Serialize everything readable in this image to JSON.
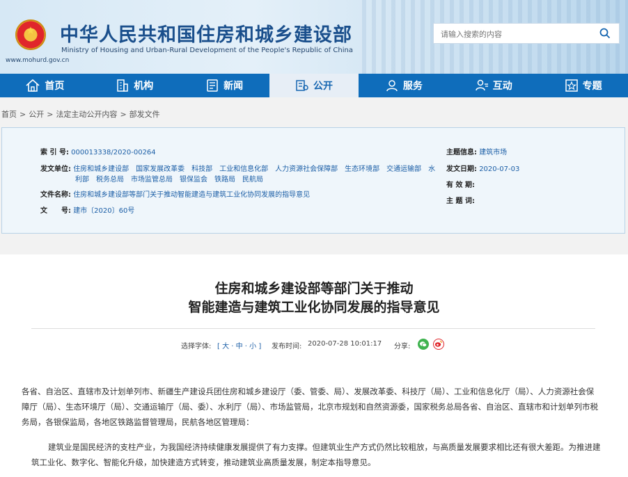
{
  "header": {
    "title": "中华人民共和国住房和城乡建设部",
    "subtitle": "Ministry of Housing and Urban-Rural Development of the People's Republic of China",
    "url": "www.mohurd.gov.cn",
    "search_placeholder": "请输入搜索的内容"
  },
  "nav": {
    "items": [
      {
        "label": "首页",
        "icon": "home-icon"
      },
      {
        "label": "机构",
        "icon": "building-icon"
      },
      {
        "label": "新闻",
        "icon": "news-icon"
      },
      {
        "label": "公开",
        "icon": "disclosure-icon"
      },
      {
        "label": "服务",
        "icon": "service-icon"
      },
      {
        "label": "互动",
        "icon": "interaction-icon"
      },
      {
        "label": "专题",
        "icon": "topic-icon"
      }
    ],
    "active": "公开"
  },
  "breadcrumb": [
    "首页",
    "公开",
    "法定主动公开内容",
    "部发文件"
  ],
  "info": {
    "index_label": "索 引 号:",
    "index_value": "000013338/2020-00264",
    "issuer_label": "发文单位:",
    "issuer_line1": "住房和城乡建设部　国家发展改革委　科技部　工业和信息化部　人力资源社会保障部　生态环境部　交通运输部　水",
    "issuer_line2": "利部　税务总局　市场监管总局　银保监会　铁路局　民航局",
    "filename_label": "文件名称:",
    "filename_value": "住房和城乡建设部等部门关于推动智能建造与建筑工业化协同发展的指导意见",
    "docno_label": "文　　号:",
    "docno_value": "建市〔2020〕60号",
    "topic_label": "主题信息:",
    "topic_value": "建筑市场",
    "date_label": "发文日期:",
    "date_value": "2020-07-03",
    "validity_label": "有 效 期:",
    "validity_value": "",
    "keywords_label": "主 题 词:",
    "keywords_value": ""
  },
  "article": {
    "title_line1": "住房和城乡建设部等部门关于推动",
    "title_line2": "智能建造与建筑工业化协同发展的指导意见",
    "font_label": "选择字体:",
    "font_sizes": "[ 大 · 中 · 小 ]",
    "publish_label": "发布时间:",
    "publish_time": "2020-07-28 10:01:17",
    "share_label": "分享:",
    "recipients": "各省、自治区、直辖市及计划单列市、新疆生产建设兵团住房和城乡建设厅（委、管委、局）、发展改革委、科技厅（局）、工业和信息化厅（局）、人力资源社会保障厅（局）、生态环境厅（局）、交通运输厅（局、委）、水利厅（局）、市场监管局，北京市规划和自然资源委，国家税务总局各省、自治区、直辖市和计划单列市税务局，各银保监局，各地区铁路监督管理局，民航各地区管理局：",
    "paragraph1": "建筑业是国民经济的支柱产业，为我国经济持续健康发展提供了有力支撑。但建筑业生产方式仍然比较粗放，与高质量发展要求相比还有很大差距。为推进建筑工业化、数字化、智能化升级，加快建造方式转变，推动建筑业高质量发展，制定本指导意见。"
  },
  "colors": {
    "nav_bg": "#0f6dbb",
    "title_blue": "#1a4f8c",
    "link_blue": "#1b5ea6",
    "wechat_green": "#3fb34f",
    "weibo_red": "#e0262b"
  }
}
